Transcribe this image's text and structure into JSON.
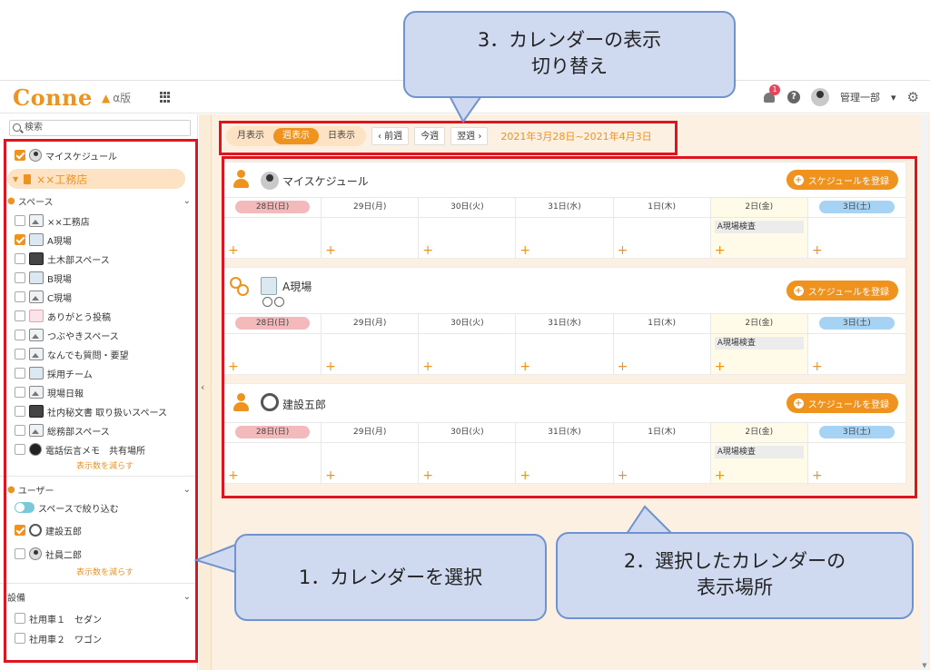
{
  "header": {
    "logo": "Conne",
    "alpha_badge": "α版",
    "notification_count": "1",
    "help_label": "?",
    "user_name": "管理一部",
    "user_caret": "▾"
  },
  "sidebar": {
    "search_placeholder": "検索",
    "my_schedule": "マイスケジュール",
    "store": "××工務店",
    "space_section": "スペース",
    "spaces": [
      "××工務店",
      "A現場",
      "土木部スペース",
      "B現場",
      "C現場",
      "ありがとう投稿",
      "つぶやきスペース",
      "なんでも質問・要望",
      "採用チーム",
      "現場日報",
      "社内秘文書 取り扱いスペース",
      "総務部スペース",
      "電話伝言メモ　共有場所"
    ],
    "show_less": "表示数を減らす",
    "user_section": "ユーザー",
    "filter_by_space": "スペースで絞り込む",
    "users": [
      "建設五郎",
      "社員二郎"
    ],
    "equipment_section": "設備",
    "equipment": [
      "社用車１　セダン",
      "社用車２　ワゴン"
    ]
  },
  "toolbar": {
    "month": "月表示",
    "week": "週表示",
    "day": "日表示",
    "prev": "‹ 前週",
    "today": "今週",
    "next": "翌週 ›",
    "range": "2021年3月28日~2021年4月3日"
  },
  "calendar": {
    "days": [
      "28日(日)",
      "29日(月)",
      "30日(火)",
      "31日(水)",
      "1日(木)",
      "2日(金)",
      "3日(土)"
    ],
    "register_button": "スケジュールを登録",
    "event": "A現場検査",
    "add_symbol": "+",
    "cards": [
      {
        "title": "マイスケジュール"
      },
      {
        "title": "A現場"
      },
      {
        "title": "建設五郎"
      }
    ]
  },
  "annotations": {
    "callout_1": "1．カレンダーを選択",
    "callout_2_line1": "2．選択したカレンダーの",
    "callout_2_line2": "表示場所",
    "callout_3_line1": "3．カレンダーの表示",
    "callout_3_line2": "切り替え"
  },
  "colors": {
    "brand_orange": "#f0921e",
    "annotation_red": "#e0141e",
    "callout_fill": "#cfdaf0",
    "callout_border": "#6e93cf"
  }
}
